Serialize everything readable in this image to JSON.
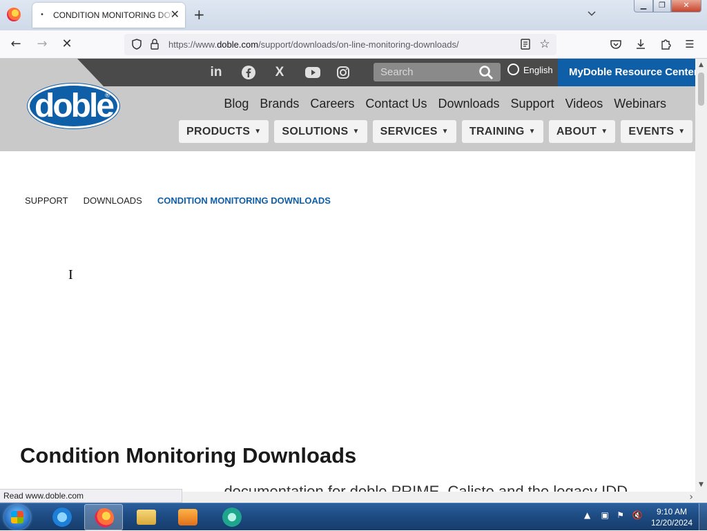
{
  "browser": {
    "tab_title": "CONDITION MONITORING DOWNLOADS",
    "tab_indicator": "•",
    "url_prefix": "https://www.",
    "url_domain": "doble.com",
    "url_path": "/support/downloads/on-line-monitoring-downloads/",
    "status_text": "Read www.doble.com"
  },
  "site": {
    "search_placeholder": "Search",
    "language": "English",
    "resource_center": "MyDoble Resource Center",
    "logo_text": "doble",
    "logo_mark": "®",
    "social": [
      "in",
      "f",
      "X",
      "▶",
      "◎"
    ],
    "top_links": [
      "Blog",
      "Brands",
      "Careers",
      "Contact Us",
      "Downloads",
      "Support",
      "Videos",
      "Webinars"
    ],
    "menus": [
      "PRODUCTS",
      "SOLUTIONS",
      "SERVICES",
      "TRAINING",
      "ABOUT",
      "EVENTS"
    ]
  },
  "breadcrumb": [
    "SUPPORT",
    "DOWNLOADS",
    "CONDITION MONITORING DOWNLOADS"
  ],
  "main": {
    "title": "Condition Monitoring Downloads",
    "partial_text": "... documentation for doble PRIME, Calisto and the legacy IDD..."
  },
  "taskbar": {
    "time": "9:10 AM",
    "date": "12/20/2024"
  },
  "colors": {
    "brand_blue": "#0f5fa8",
    "header_gray": "#c9c9c9",
    "top_strip": "#4a4a4a"
  }
}
